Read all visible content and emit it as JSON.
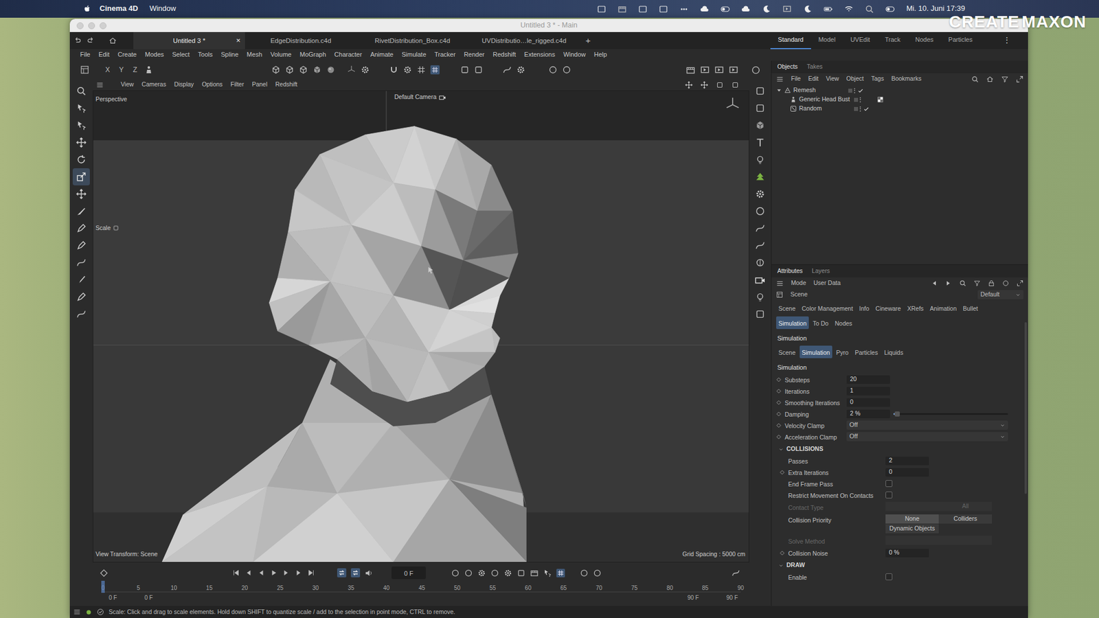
{
  "os_menubar": {
    "app": "Cinema 4D",
    "menus": [
      "Window"
    ],
    "clock": "Mi. 10. Juni 17:39"
  },
  "watermark": {
    "first": "CREATE",
    "second": "MAXON"
  },
  "window": {
    "title": "Untitled 3 * - Main"
  },
  "doc_tabs": {
    "tabs": [
      {
        "label": "Untitled 3 *",
        "selected": true,
        "close": "×"
      },
      {
        "label": "EdgeDistribution.c4d",
        "selected": false
      },
      {
        "label": "RivetDistribution_Box.c4d",
        "selected": false
      },
      {
        "label": "UVDistributio…le_rigged.c4d",
        "selected": false
      }
    ],
    "add": "+"
  },
  "layouts": {
    "items": [
      {
        "label": "Standard",
        "selected": true
      },
      {
        "label": "Model",
        "selected": false
      },
      {
        "label": "UVEdit",
        "selected": false
      },
      {
        "label": "Track",
        "selected": false
      },
      {
        "label": "Nodes",
        "selected": false
      },
      {
        "label": "Particles",
        "selected": false
      }
    ],
    "more": "⋮"
  },
  "menu": [
    "File",
    "Edit",
    "Create",
    "Modes",
    "Select",
    "Tools",
    "Spline",
    "Mesh",
    "Volume",
    "MoGraph",
    "Character",
    "Animate",
    "Simulate",
    "Tracker",
    "Render",
    "Redshift",
    "Extensions",
    "Window",
    "Help"
  ],
  "axis_buttons": [
    "X",
    "Y",
    "Z"
  ],
  "viewport": {
    "menu": [
      "View",
      "Cameras",
      "Display",
      "Options",
      "Filter",
      "Panel",
      "Redshift"
    ],
    "camera": "Perspective",
    "default_camera": "Default Camera",
    "tool_label": "Scale",
    "view_transform": "View Transform: Scene",
    "grid_spacing": "Grid Spacing : 5000 cm"
  },
  "objects_panel": {
    "tabs": [
      {
        "label": "Objects",
        "selected": true
      },
      {
        "label": "Takes",
        "selected": false
      }
    ],
    "menu": [
      "File",
      "Edit",
      "View",
      "Object",
      "Tags",
      "Bookmarks"
    ],
    "items": [
      {
        "name": "Remesh",
        "depth": 0,
        "expanded": true,
        "checked": true,
        "tag": false
      },
      {
        "name": "Generic Head Bust",
        "depth": 1,
        "checked": false,
        "tag": true
      },
      {
        "name": "Random",
        "depth": 1,
        "checked": true,
        "tag": false
      }
    ]
  },
  "attributes": {
    "tabs": [
      {
        "label": "Attributes",
        "selected": true
      },
      {
        "label": "Layers",
        "selected": false
      }
    ],
    "menu": [
      "Mode",
      "User Data"
    ],
    "object": "Scene",
    "preset": "Default",
    "tab_rows": [
      [
        {
          "label": "Scene",
          "selected": false
        },
        {
          "label": "Color Management",
          "selected": false
        },
        {
          "label": "Info",
          "selected": false
        },
        {
          "label": "Cineware",
          "selected": false
        },
        {
          "label": "XRefs",
          "selected": false
        },
        {
          "label": "Animation",
          "selected": false
        },
        {
          "label": "Bullet",
          "selected": false
        }
      ],
      [
        {
          "label": "Simulation",
          "selected": true
        },
        {
          "label": "To Do",
          "selected": false
        },
        {
          "label": "Nodes",
          "selected": false
        }
      ]
    ],
    "section": "Simulation",
    "subtabs": [
      {
        "label": "Scene",
        "selected": false
      },
      {
        "label": "Simulation",
        "selected": true
      },
      {
        "label": "Pyro",
        "selected": false
      },
      {
        "label": "Particles",
        "selected": false
      },
      {
        "label": "Liquids",
        "selected": false
      }
    ],
    "subsection": "Simulation",
    "fields": [
      {
        "label": "Substeps",
        "kind": "number",
        "value": "20",
        "key": true
      },
      {
        "label": "Iterations",
        "kind": "number",
        "value": "1",
        "key": true
      },
      {
        "label": "Smoothing Iterations",
        "kind": "number",
        "value": "0",
        "key": true
      },
      {
        "label": "Damping",
        "kind": "slider",
        "value": "2 %",
        "level": 0.02,
        "key": true
      },
      {
        "label": "Velocity Clamp",
        "kind": "dropdown",
        "value": "Off",
        "key": true
      },
      {
        "label": "Acceleration Clamp",
        "kind": "dropdown",
        "value": "Off",
        "key": true
      }
    ],
    "collisions": {
      "title": "COLLISIONS",
      "expanded": true,
      "fields": [
        {
          "label": "Passes",
          "kind": "number",
          "value": "2",
          "key": false,
          "disabled": false
        },
        {
          "label": "Extra Iterations",
          "kind": "number",
          "value": "0",
          "key": true,
          "disabled": false
        },
        {
          "label": "End Frame Pass",
          "kind": "checkbox",
          "checked": false,
          "key": false,
          "disabled": false
        },
        {
          "label": "Restrict Movement On Contacts",
          "kind": "checkbox",
          "checked": false,
          "key": false,
          "disabled": false
        },
        {
          "label": "Contact Type",
          "kind": "segmented",
          "key": false,
          "disabled": true,
          "options": [
            {
              "selected": false
            },
            {
              "label": "All",
              "selected": false
            }
          ]
        },
        {
          "label": "Collision Priority",
          "kind": "segmented",
          "key": false,
          "disabled": false,
          "options": [
            {
              "label": "None",
              "selected": true
            },
            {
              "label": "Colliders",
              "selected": false
            },
            {
              "label": "Dynamic Objects",
              "selected": false
            }
          ]
        },
        {
          "label": "Solve Method",
          "kind": "segmented",
          "key": false,
          "disabled": true,
          "options": [
            {
              "selected": false
            },
            {
              "selected": false
            }
          ]
        },
        {
          "label": "Collision Noise",
          "kind": "number",
          "value": "0 %",
          "key": true,
          "disabled": false
        }
      ]
    },
    "draw": {
      "title": "DRAW",
      "expanded": true,
      "fields": [
        {
          "label": "Enable",
          "kind": "checkbox",
          "checked": false,
          "key": false,
          "disabled": false
        }
      ]
    }
  },
  "timeline": {
    "current_frame": "0 F",
    "ticks": [
      "0",
      "5",
      "10",
      "15",
      "20",
      "25",
      "30",
      "35",
      "40",
      "45",
      "50",
      "55",
      "60",
      "65",
      "70",
      "75",
      "80",
      "85",
      "90"
    ],
    "playhead": {
      "level": 0
    },
    "start": [
      "0 F",
      "0 F"
    ],
    "end": [
      "90 F",
      "90 F"
    ]
  },
  "status_bar": {
    "message": "Scale: Click and drag to scale elements. Hold down SHIFT to quantize scale / add to the selection in point mode, CTRL to remove."
  }
}
